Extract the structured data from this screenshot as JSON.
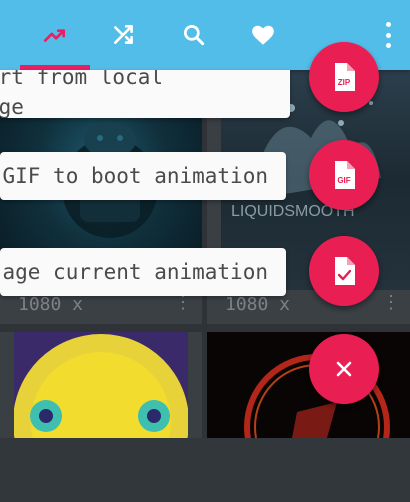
{
  "grid": {
    "cards": [
      {
        "dims": "1080 x",
        "more": "⋮"
      },
      {
        "dims": "1080 x",
        "more": "⋮",
        "thumb_caption": "LIQUIDSMOOTH"
      }
    ]
  },
  "appbar": {
    "tabs": [
      {
        "name": "trending",
        "icon": "trending-up-icon",
        "selected": true
      },
      {
        "name": "shuffle",
        "icon": "shuffle-icon"
      },
      {
        "name": "search",
        "icon": "search-icon"
      },
      {
        "name": "favorites",
        "icon": "heart-icon"
      }
    ],
    "overflow_icon": "more-vert-icon"
  },
  "fab_menu": {
    "items": [
      {
        "label": "ort from local\nage",
        "icon": "zip-file-icon"
      },
      {
        "label": "GIF to boot animation",
        "icon": "gif-file-icon"
      },
      {
        "label": "age current animation",
        "icon": "file-check-icon"
      }
    ],
    "close_icon": "close-icon"
  },
  "colors": {
    "appbar": "#52bde8",
    "accent": "#e91e52",
    "background": "#2b2f33"
  }
}
